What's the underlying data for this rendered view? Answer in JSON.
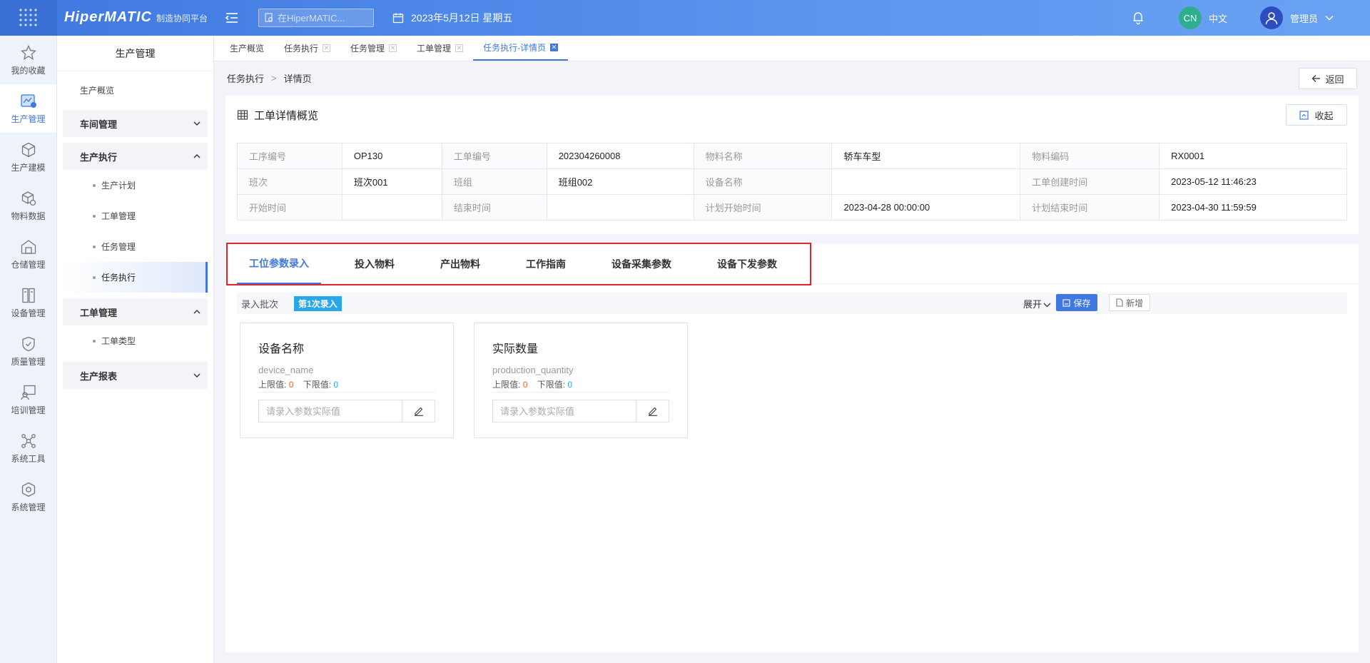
{
  "header": {
    "logo": "HiperMATIC",
    "logo_sub": "制造协同平台",
    "search_placeholder": "在HiperMATIC...",
    "date": "2023年5月12日 星期五",
    "lang_badge": "CN",
    "lang_label": "中文",
    "user_name": "管理员"
  },
  "rail": [
    {
      "label": "我的收藏",
      "icon": "star-icon"
    },
    {
      "label": "生产管理",
      "icon": "production-icon"
    },
    {
      "label": "生产建模",
      "icon": "cube-icon"
    },
    {
      "label": "物料数据",
      "icon": "material-icon"
    },
    {
      "label": "仓储管理",
      "icon": "warehouse-icon"
    },
    {
      "label": "设备管理",
      "icon": "device-icon"
    },
    {
      "label": "质量管理",
      "icon": "shield-icon"
    },
    {
      "label": "培训管理",
      "icon": "training-icon"
    },
    {
      "label": "系统工具",
      "icon": "network-icon"
    },
    {
      "label": "系统管理",
      "icon": "settings-icon"
    }
  ],
  "sidebar": {
    "title": "生产管理",
    "overview": "生产概览",
    "groups": [
      {
        "label": "车间管理"
      },
      {
        "label": "生产执行",
        "items": [
          "生产计划",
          "工单管理",
          "任务管理",
          "任务执行"
        ]
      },
      {
        "label": "工单管理",
        "items": [
          "工单类型"
        ]
      },
      {
        "label": "生产报表"
      }
    ]
  },
  "tabs": [
    "生产概览",
    "任务执行",
    "任务管理",
    "工单管理",
    "任务执行-详情页"
  ],
  "breadcrumb": {
    "parent": "任务执行",
    "sep": ">",
    "current": "详情页"
  },
  "back_label": "返回",
  "detail": {
    "title": "工单详情概览",
    "collapse_label": "收起",
    "rows": [
      [
        [
          "工序编号",
          "OP130"
        ],
        [
          "工单编号",
          "202304260008"
        ],
        [
          "物料名称",
          "轿车车型"
        ],
        [
          "物料编码",
          "RX0001"
        ]
      ],
      [
        [
          "班次",
          "班次001"
        ],
        [
          "班组",
          "班组002"
        ],
        [
          "设备名称",
          ""
        ],
        [
          "工单创建时间",
          "2023-05-12 11:46:23"
        ]
      ],
      [
        [
          "开始时间",
          ""
        ],
        [
          "结束时间",
          ""
        ],
        [
          "计划开始时间",
          "2023-04-28 00:00:00"
        ],
        [
          "计划结束时间",
          "2023-04-30 11:59:59"
        ]
      ]
    ]
  },
  "panel": {
    "tabs": [
      "工位参数录入",
      "投入物料",
      "产出物料",
      "工作指南",
      "设备采集参数",
      "设备下发参数"
    ],
    "batch_label": "录入批次",
    "batch_tag": "第1次录入",
    "expand": "展开",
    "save": "保存",
    "add": "新增",
    "upper_label": "上限值:",
    "lower_label": "下限值:",
    "params": [
      {
        "title": "设备名称",
        "code": "device_name",
        "upper": "0",
        "lower": "0",
        "placeholder": "请录入参数实际值"
      },
      {
        "title": "实际数量",
        "code": "production_quantity",
        "upper": "0",
        "lower": "0",
        "placeholder": "请录入参数实际值"
      }
    ]
  }
}
